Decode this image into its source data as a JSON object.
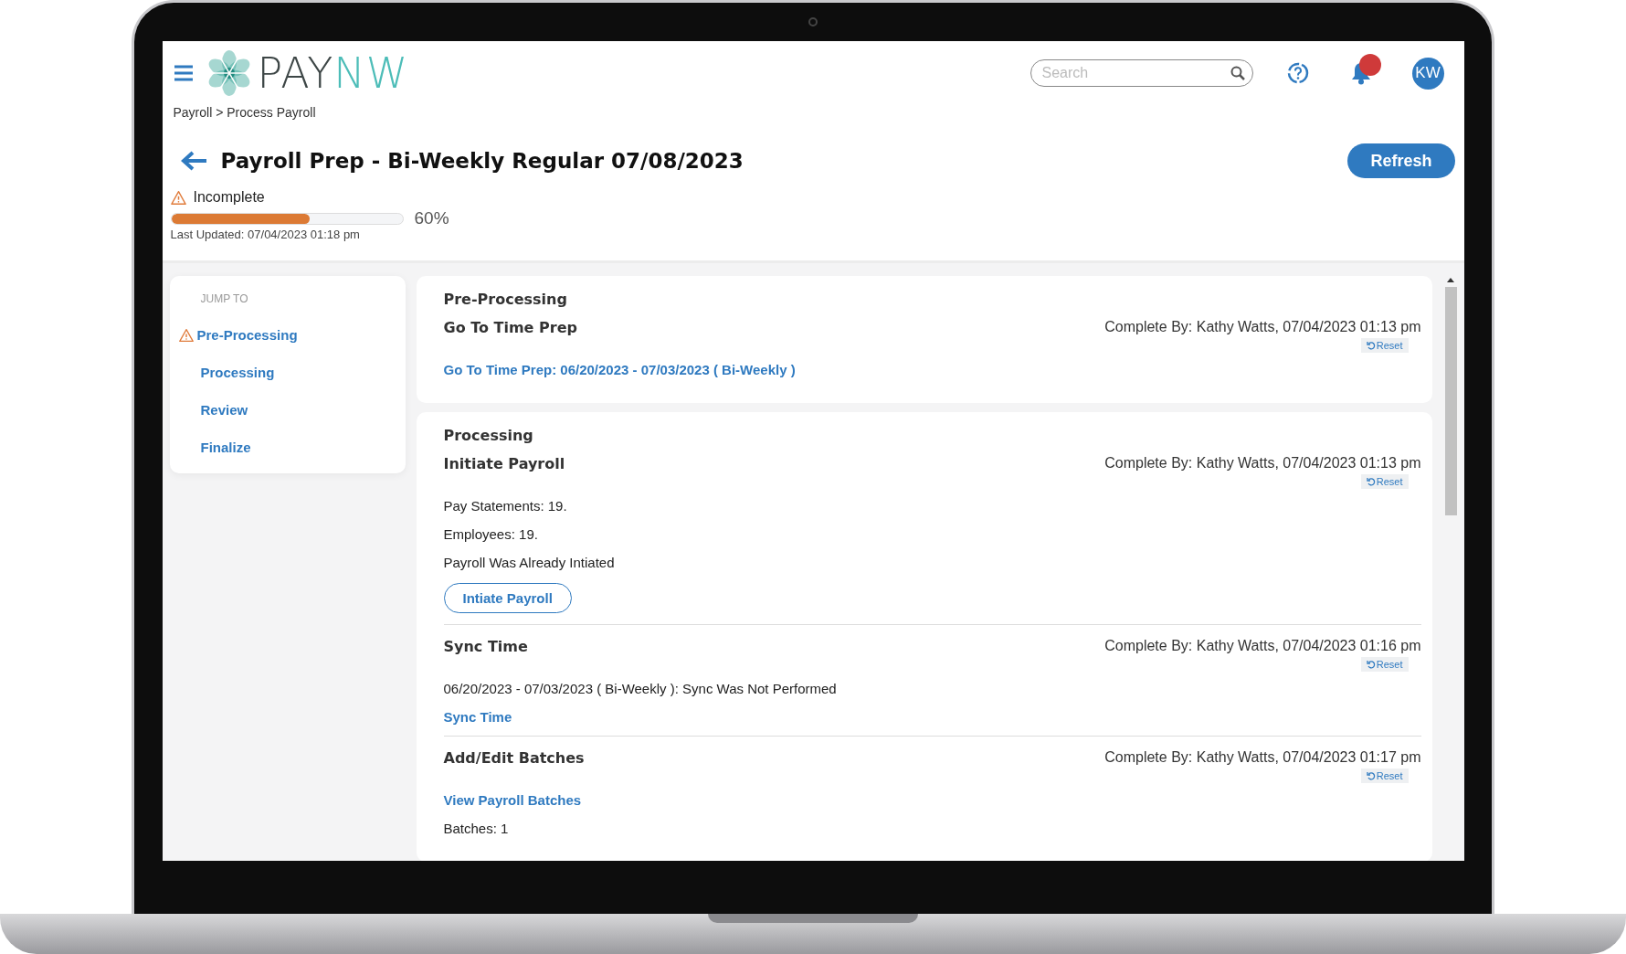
{
  "header": {
    "logo": {
      "first": "PAY",
      "second": "NW"
    },
    "search": {
      "placeholder": "Search"
    },
    "has_notifications": true,
    "avatar": "KW"
  },
  "breadcrumb": "Payroll > Process Payroll",
  "page_title": "Payroll Prep - Bi-Weekly Regular 07/08/2023",
  "refresh_button": "Refresh",
  "status": {
    "label": "Incomplete",
    "warning": true,
    "level": 0.6,
    "percent": "60%",
    "last_updated": "Last Updated: 07/04/2023 01:18 pm"
  },
  "jump_to": {
    "heading": "JUMP TO",
    "items": [
      {
        "label": "Pre-Processing",
        "warning": true
      },
      {
        "label": "Processing",
        "warning": false
      },
      {
        "label": "Review",
        "warning": false
      },
      {
        "label": "Finalize",
        "warning": false
      }
    ]
  },
  "sections": [
    {
      "title": "Pre-Processing",
      "steps": [
        {
          "title": "Go To Time Prep",
          "completed_by": "Complete By: Kathy Watts, 07/04/2023 01:13 pm",
          "reset": "Reset",
          "lines": [
            {
              "kind": "link",
              "text": "Go To Time Prep: 06/20/2023 - 07/03/2023 ( Bi-Weekly )"
            }
          ]
        }
      ]
    },
    {
      "title": "Processing",
      "steps": [
        {
          "title": "Initiate Payroll",
          "completed_by": "Complete By: Kathy Watts, 07/04/2023 01:13 pm",
          "reset": "Reset",
          "lines": [
            {
              "kind": "text",
              "text": "Pay Statements: 19."
            },
            {
              "kind": "text",
              "text": "Employees: 19."
            },
            {
              "kind": "text",
              "text": "Payroll Was Already Intiated"
            },
            {
              "kind": "button",
              "text": "Intiate Payroll"
            }
          ]
        },
        {
          "title": "Sync Time",
          "completed_by": "Complete By: Kathy Watts, 07/04/2023 01:16 pm",
          "reset": "Reset",
          "lines": [
            {
              "kind": "text",
              "text": "06/20/2023 - 07/03/2023 ( Bi-Weekly ): Sync Was Not Performed"
            },
            {
              "kind": "link",
              "text": "Sync Time"
            }
          ]
        },
        {
          "title": "Add/Edit Batches",
          "completed_by": "Complete By: Kathy Watts, 07/04/2023 01:17 pm",
          "reset": "Reset",
          "lines": [
            {
              "kind": "link",
              "text": "View Payroll Batches"
            },
            {
              "kind": "text",
              "text": "Batches: 1"
            }
          ]
        }
      ]
    }
  ]
}
